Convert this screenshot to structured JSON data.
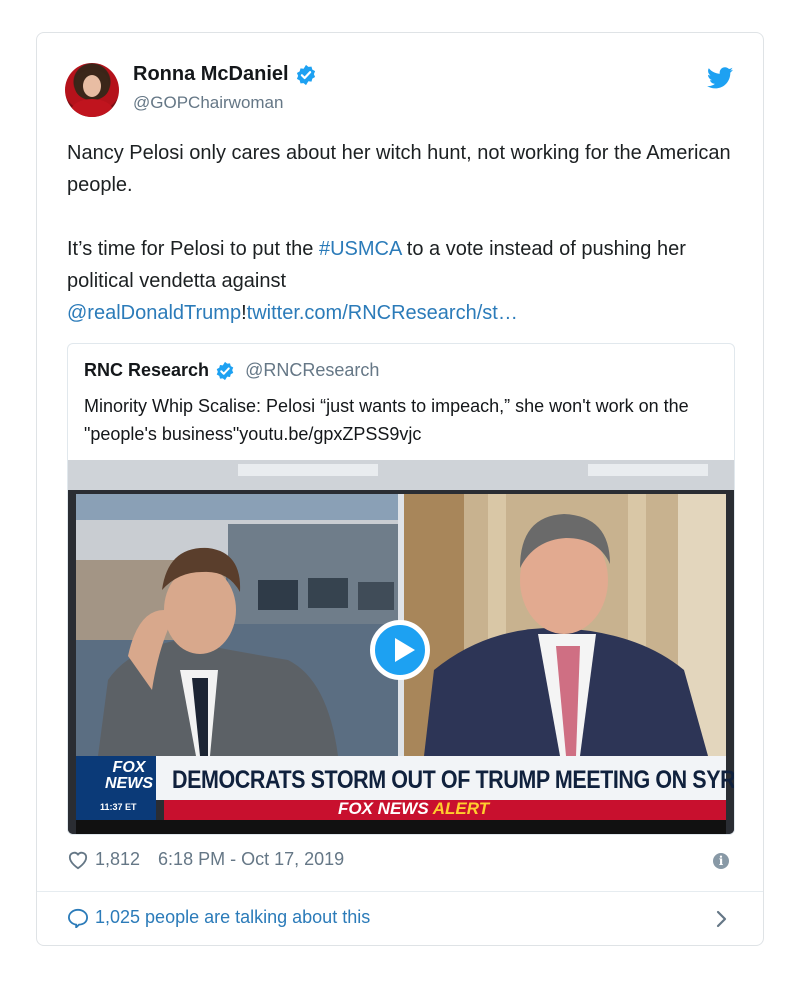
{
  "tweet": {
    "author_name": "Ronna McDaniel",
    "author_handle": "@GOPChairwoman",
    "paragraph1": "Nancy Pelosi only cares about her witch hunt, not working for the American people.",
    "p2_part1": "It’s time for Pelosi to put the ",
    "p2_hashtag": "#USMCA",
    "p2_part2": " to a vote instead of pushing her political vendetta against ",
    "p2_mention": "@realDonaldTrump",
    "p2_bang": "!",
    "p2_link": "twitter.com/RNCResearch/st…",
    "likes": "1,812",
    "timestamp": "6:18 PM - Oct 17, 2019",
    "conversation": "1,025 people are talking about this"
  },
  "quote": {
    "author_name": "RNC Research",
    "author_handle": "@RNCResearch",
    "text": "Minority Whip Scalise: Pelosi “just wants to impeach,” she won't work on the \"people's business\"youtu.be/gpxZPSS9vjc"
  },
  "video": {
    "chyron": "DEMOCRATS STORM OUT OF TRUMP MEETING ON SYRIA",
    "alert_brand": "FOX NEWS ",
    "alert_word": "ALERT",
    "logo_text_1": "FOX",
    "logo_text_2": "NEWS",
    "clock": "11:37 ET"
  },
  "icons": {
    "verified": "verified-badge-icon",
    "bird": "twitter-bird-icon",
    "heart": "heart-icon",
    "info": "info-icon",
    "bubble": "speech-bubble-icon",
    "chevron": "chevron-right-icon",
    "play": "play-icon"
  },
  "colors": {
    "link": "#2b7bb9",
    "twitter_blue": "#1da1f2",
    "muted": "#657786"
  }
}
